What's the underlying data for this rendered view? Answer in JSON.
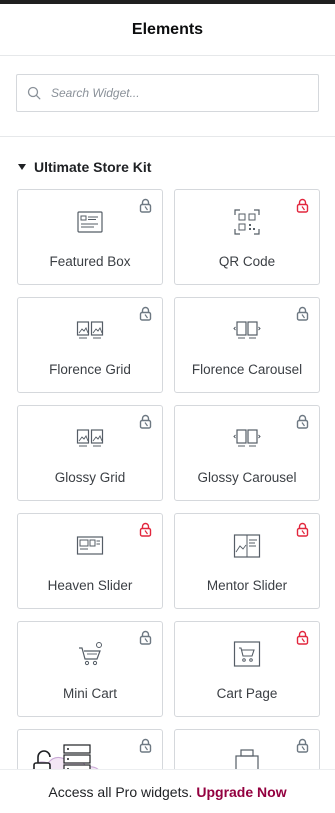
{
  "header": {
    "title": "Elements"
  },
  "search": {
    "placeholder": "Search Widget..."
  },
  "category": {
    "name": "Ultimate Store Kit"
  },
  "widgets": [
    {
      "label": "Featured Box",
      "lock_color": "#6d7882"
    },
    {
      "label": "QR Code",
      "lock_color": "#e2263d"
    },
    {
      "label": "Florence Grid",
      "lock_color": "#6d7882"
    },
    {
      "label": "Florence Carousel",
      "lock_color": "#6d7882"
    },
    {
      "label": "Glossy Grid",
      "lock_color": "#6d7882"
    },
    {
      "label": "Glossy Carousel",
      "lock_color": "#6d7882"
    },
    {
      "label": "Heaven Slider",
      "lock_color": "#e2263d"
    },
    {
      "label": "Mentor Slider",
      "lock_color": "#e2263d"
    },
    {
      "label": "Mini Cart",
      "lock_color": "#6d7882"
    },
    {
      "label": "Cart Page",
      "lock_color": "#e2263d"
    },
    {
      "label": "",
      "lock_color": "#6d7882"
    },
    {
      "label": "",
      "lock_color": "#6d7882"
    }
  ],
  "footer": {
    "text": "Access all Pro widgets.",
    "link": "Upgrade Now"
  }
}
